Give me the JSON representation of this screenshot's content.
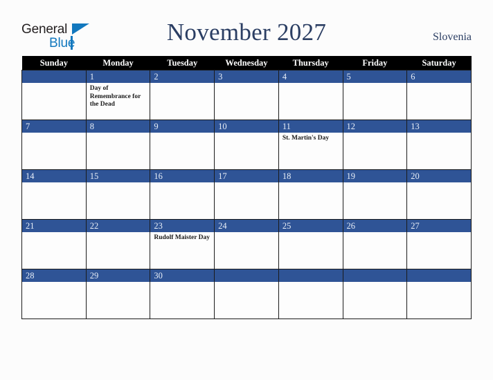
{
  "brand": {
    "name_dark": "General",
    "name_blue": "Blue",
    "triangle_icon": "triangle-icon",
    "accent_blue": "#1278be",
    "dark_text": "#231f20"
  },
  "header": {
    "title": "November 2027",
    "country": "Slovenia",
    "title_color": "#2b3e63"
  },
  "theme": {
    "daynum_band": "#2f5496",
    "weekday_header_bg": "#000000",
    "weekday_header_fg": "#ffffff",
    "cell_bg": "#fdfdfd",
    "page_bg": "#fcfcfc",
    "border": "#1a1a1a"
  },
  "calendar": {
    "month": "November",
    "year": "2027",
    "weekdays": [
      "Sunday",
      "Monday",
      "Tuesday",
      "Wednesday",
      "Thursday",
      "Friday",
      "Saturday"
    ],
    "weeks": [
      [
        {
          "day": "",
          "events": []
        },
        {
          "day": "1",
          "events": [
            "Day of Remembrance for the Dead"
          ]
        },
        {
          "day": "2",
          "events": []
        },
        {
          "day": "3",
          "events": []
        },
        {
          "day": "4",
          "events": []
        },
        {
          "day": "5",
          "events": []
        },
        {
          "day": "6",
          "events": []
        }
      ],
      [
        {
          "day": "7",
          "events": []
        },
        {
          "day": "8",
          "events": []
        },
        {
          "day": "9",
          "events": []
        },
        {
          "day": "10",
          "events": []
        },
        {
          "day": "11",
          "events": [
            "St. Martin's Day"
          ]
        },
        {
          "day": "12",
          "events": []
        },
        {
          "day": "13",
          "events": []
        }
      ],
      [
        {
          "day": "14",
          "events": []
        },
        {
          "day": "15",
          "events": []
        },
        {
          "day": "16",
          "events": []
        },
        {
          "day": "17",
          "events": []
        },
        {
          "day": "18",
          "events": []
        },
        {
          "day": "19",
          "events": []
        },
        {
          "day": "20",
          "events": []
        }
      ],
      [
        {
          "day": "21",
          "events": []
        },
        {
          "day": "22",
          "events": []
        },
        {
          "day": "23",
          "events": [
            "Rudolf Maister Day"
          ]
        },
        {
          "day": "24",
          "events": []
        },
        {
          "day": "25",
          "events": []
        },
        {
          "day": "26",
          "events": []
        },
        {
          "day": "27",
          "events": []
        }
      ],
      [
        {
          "day": "28",
          "events": []
        },
        {
          "day": "29",
          "events": []
        },
        {
          "day": "30",
          "events": []
        },
        {
          "day": "",
          "events": []
        },
        {
          "day": "",
          "events": []
        },
        {
          "day": "",
          "events": []
        },
        {
          "day": "",
          "events": []
        }
      ]
    ]
  }
}
